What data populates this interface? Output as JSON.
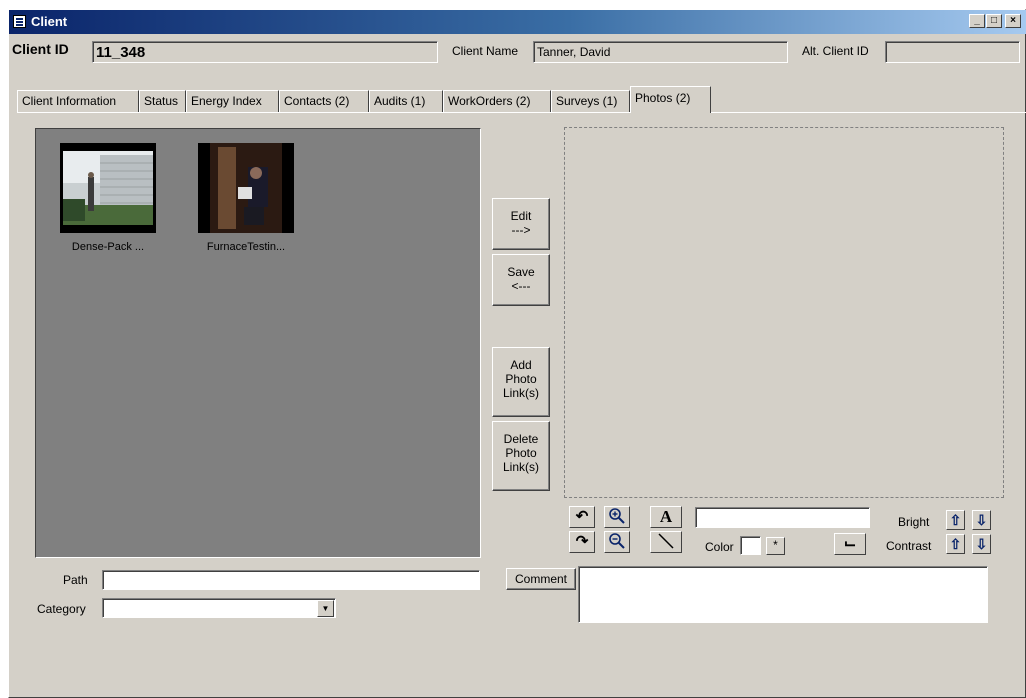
{
  "window": {
    "title": "Client",
    "minimize": "_",
    "maximize": "□",
    "close": "×"
  },
  "header": {
    "client_id_label": "Client ID",
    "client_id_value": "11_348",
    "client_name_label": "Client Name",
    "client_name_value": "Tanner, David",
    "alt_client_id_label": "Alt. Client ID",
    "alt_client_id_value": ""
  },
  "tabs": [
    {
      "label": "Client Information"
    },
    {
      "label": "Status"
    },
    {
      "label": "Energy Index"
    },
    {
      "label": "Contacts (2)"
    },
    {
      "label": "Audits (1)"
    },
    {
      "label": "WorkOrders (2)"
    },
    {
      "label": "Surveys (1)"
    },
    {
      "label": "Photos (2)",
      "active": true
    }
  ],
  "gallery": {
    "photos": [
      {
        "caption": "Dense-Pack ..."
      },
      {
        "caption": "FurnaceTestin..."
      }
    ]
  },
  "actions": {
    "edit": "Edit\n--->",
    "save": "Save\n<---",
    "add": "Add\nPhoto\nLink(s)",
    "delete": "Delete\nPhoto\nLink(s)"
  },
  "tools": {
    "rotate_left_icon": "rotate-left-icon",
    "rotate_right_icon": "rotate-right-icon",
    "zoom_in_icon": "zoom-in-icon",
    "zoom_out_icon": "zoom-out-icon",
    "text_tool": "A",
    "text_input_value": "",
    "color_label": "Color",
    "bright_label": "Bright",
    "contrast_label": "Contrast"
  },
  "fields": {
    "path_label": "Path",
    "path_value": "",
    "category_label": "Category",
    "category_value": "",
    "comment_button": "Comment",
    "comment_value": ""
  },
  "colors": {
    "title_bar_start": "#0a246a",
    "title_bar_end": "#a6caf0",
    "window_face": "#d4d0c8",
    "gallery_bg": "#808080",
    "arrow_blue": "#0a246a"
  }
}
